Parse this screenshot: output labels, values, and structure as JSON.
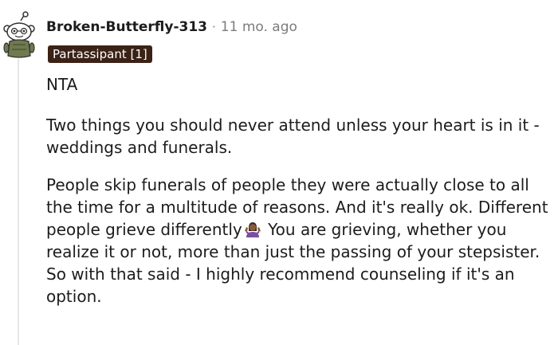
{
  "comment": {
    "username": "Broken-Butterfly-313",
    "separator": "·",
    "timestamp": "11 mo. ago",
    "flair": "Partassipant [1]",
    "avatar_icon": "snoo-avatar-icon",
    "emoji_icon": "person-shrugging-emoji-icon",
    "paragraphs": {
      "p1": "NTA",
      "p2_line1": "Two things you should never attend unless your heart is in it -",
      "p2_line2": "weddings and funerals.",
      "p3_line1": "People skip funerals of people they were actually close to all",
      "p3_line2": "the time for a multitude of reasons. And it's really ok. Different",
      "p3_line3a": "people grieve differently",
      "p3_line3b": "You are grieving, whether you",
      "p3_line4": "realize it or not, more than just the passing of your stepsister.",
      "p3_line5": "So with that said - I highly recommend counseling if it's an",
      "p3_line6": "option."
    }
  },
  "colors": {
    "flair_bg": "#3b2216",
    "meta_text": "#7c7c7c",
    "thread_line": "#e5e6e8"
  }
}
